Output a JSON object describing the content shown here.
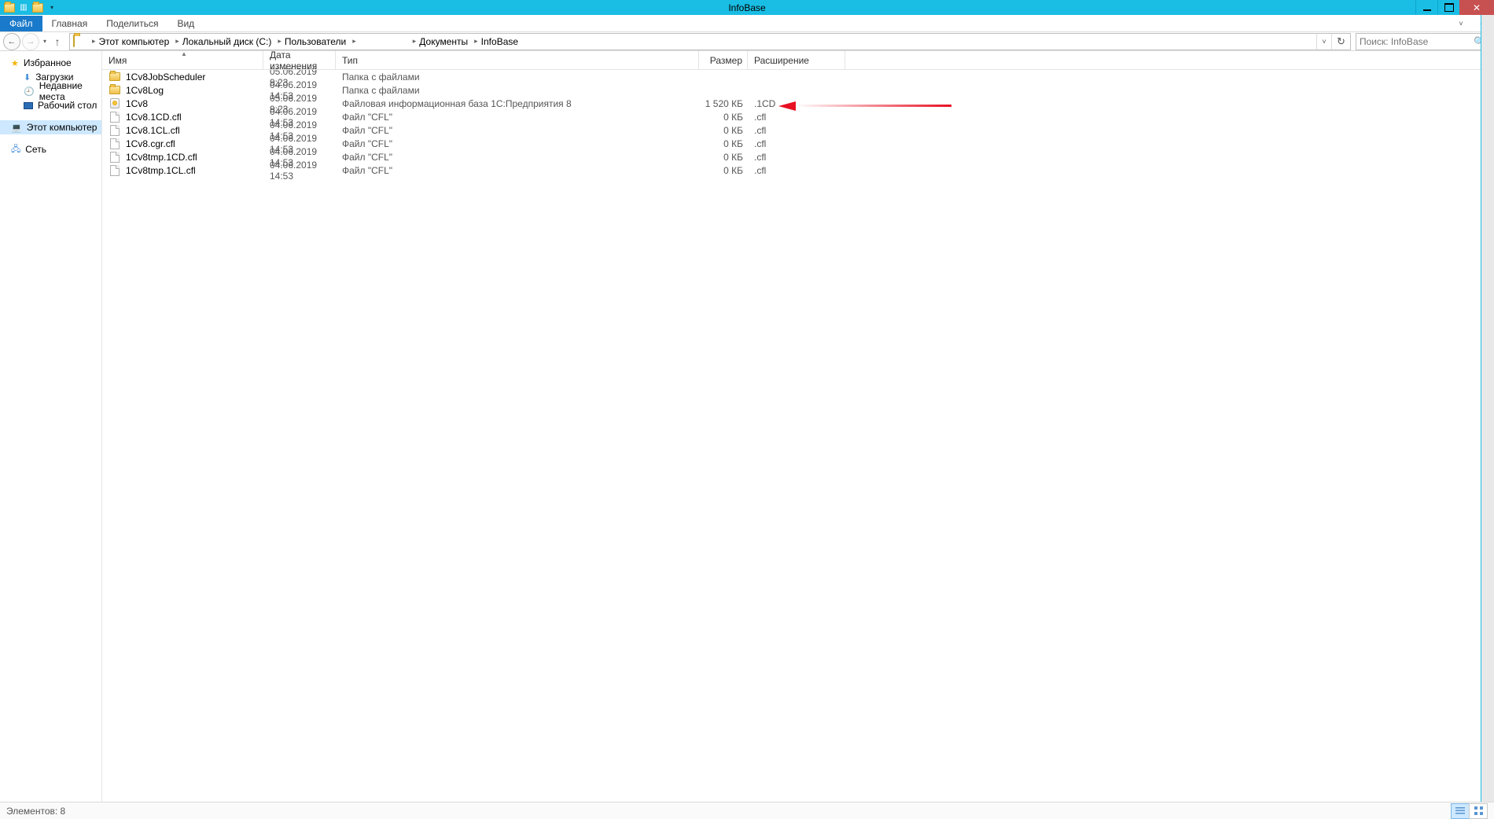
{
  "window": {
    "title": "InfoBase"
  },
  "ribbon": {
    "file": "Файл",
    "tabs": [
      "Главная",
      "Поделиться",
      "Вид"
    ]
  },
  "breadcrumb": {
    "items": [
      "Этот компьютер",
      "Локальный диск (C:)",
      "Пользователи",
      "",
      "Документы",
      "InfoBase"
    ]
  },
  "search": {
    "placeholder": "Поиск: InfoBase"
  },
  "sidebar": {
    "favorites": {
      "label": "Избранное",
      "items": [
        {
          "label": "Загрузки",
          "icon": "download-icon"
        },
        {
          "label": "Недавние места",
          "icon": "recent-icon"
        },
        {
          "label": "Рабочий стол",
          "icon": "desktop-icon"
        }
      ]
    },
    "this_pc": {
      "label": "Этот компьютер"
    },
    "network": {
      "label": "Сеть"
    }
  },
  "columns": {
    "name": "Имя",
    "date": "Дата изменения",
    "type": "Тип",
    "size": "Размер",
    "ext": "Расширение"
  },
  "files": [
    {
      "icon": "folder",
      "name": "1Cv8JobScheduler",
      "date": "05.06.2019 9:23",
      "type": "Папка с файлами",
      "size": "",
      "ext": ""
    },
    {
      "icon": "folder",
      "name": "1Cv8Log",
      "date": "04.06.2019 14:53",
      "type": "Папка с файлами",
      "size": "",
      "ext": ""
    },
    {
      "icon": "db",
      "name": "1Cv8",
      "date": "05.06.2019 9:23",
      "type": "Файловая информационная база 1С:Предприятия 8",
      "size": "1 520 КБ",
      "ext": ".1CD"
    },
    {
      "icon": "file",
      "name": "1Cv8.1CD.cfl",
      "date": "04.06.2019 14:53",
      "type": "Файл \"CFL\"",
      "size": "0 КБ",
      "ext": ".cfl"
    },
    {
      "icon": "file",
      "name": "1Cv8.1CL.cfl",
      "date": "04.06.2019 14:53",
      "type": "Файл \"CFL\"",
      "size": "0 КБ",
      "ext": ".cfl"
    },
    {
      "icon": "file",
      "name": "1Cv8.cgr.cfl",
      "date": "04.06.2019 14:53",
      "type": "Файл \"CFL\"",
      "size": "0 КБ",
      "ext": ".cfl"
    },
    {
      "icon": "file",
      "name": "1Cv8tmp.1CD.cfl",
      "date": "04.06.2019 14:53",
      "type": "Файл \"CFL\"",
      "size": "0 КБ",
      "ext": ".cfl"
    },
    {
      "icon": "file",
      "name": "1Cv8tmp.1CL.cfl",
      "date": "04.06.2019 14:53",
      "type": "Файл \"CFL\"",
      "size": "0 КБ",
      "ext": ".cfl"
    }
  ],
  "statusbar": {
    "text": "Элементов: 8"
  }
}
